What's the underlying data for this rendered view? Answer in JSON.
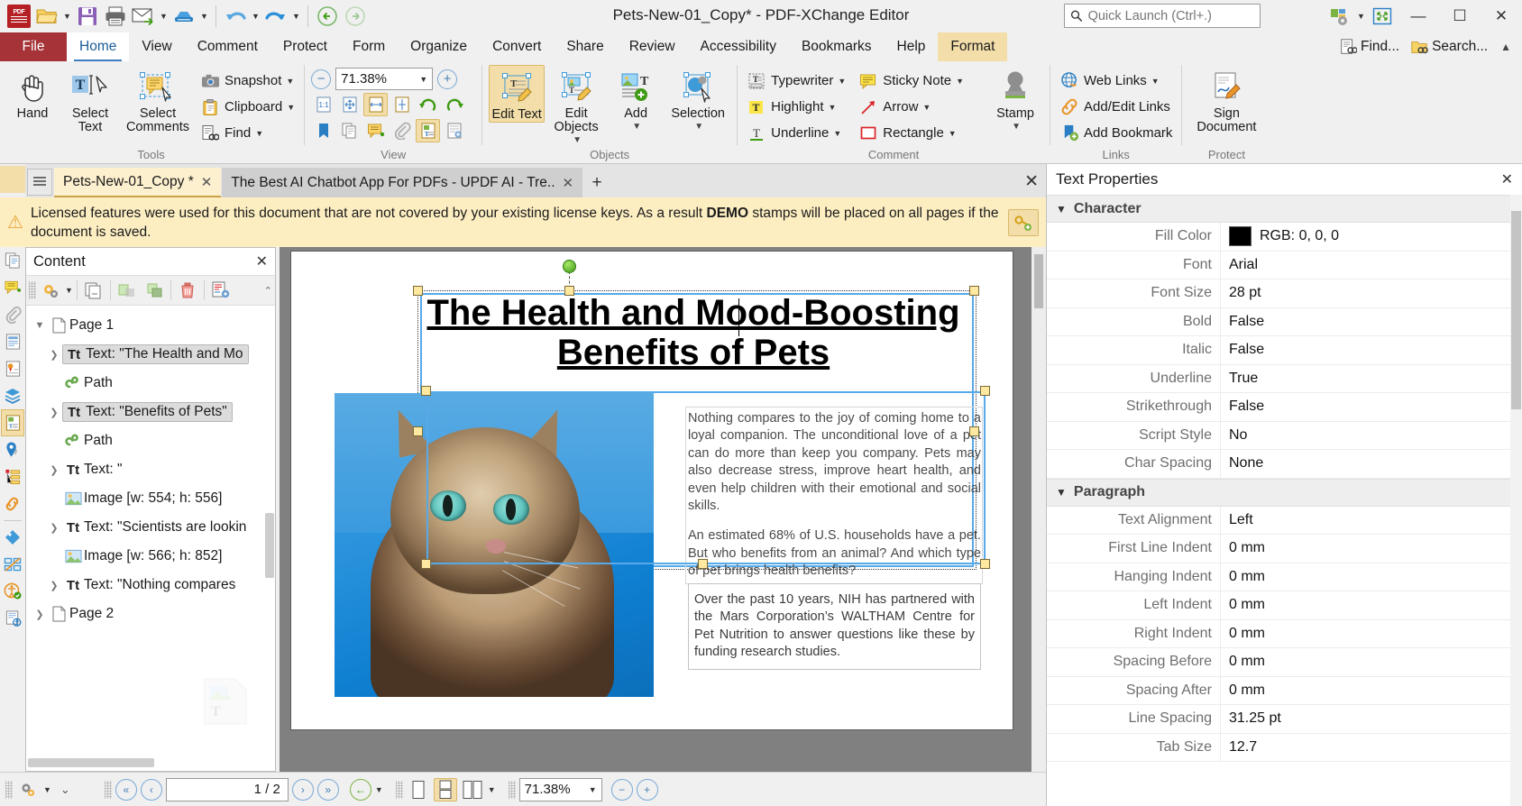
{
  "window": {
    "title": "Pets-New-01_Copy* - PDF-XChange Editor",
    "minimize_label": "—",
    "maximize_label": "☐",
    "close_label": "✕"
  },
  "quick_access": {
    "items": [
      {
        "name": "app-logo",
        "label": "PDF"
      },
      {
        "name": "open-file",
        "label": "Open"
      },
      {
        "name": "save-file",
        "label": "Save"
      },
      {
        "name": "print",
        "label": "Print"
      },
      {
        "name": "email",
        "label": "Email"
      },
      {
        "name": "scan",
        "label": "Scan"
      },
      {
        "name": "undo",
        "label": "Undo"
      },
      {
        "name": "redo",
        "label": "Redo"
      },
      {
        "name": "previous-view",
        "label": "Previous View"
      },
      {
        "name": "next-view",
        "label": "Next View"
      }
    ]
  },
  "quick_launch": {
    "placeholder": "Quick Launch (Ctrl+.)",
    "value": ""
  },
  "menu": {
    "file_label": "File",
    "tabs": [
      {
        "label": "Home",
        "state": "active"
      },
      {
        "label": "View",
        "state": "normal"
      },
      {
        "label": "Comment",
        "state": "normal"
      },
      {
        "label": "Protect",
        "state": "normal"
      },
      {
        "label": "Form",
        "state": "normal"
      },
      {
        "label": "Organize",
        "state": "normal"
      },
      {
        "label": "Convert",
        "state": "normal"
      },
      {
        "label": "Share",
        "state": "normal"
      },
      {
        "label": "Review",
        "state": "normal"
      },
      {
        "label": "Accessibility",
        "state": "normal"
      },
      {
        "label": "Bookmarks",
        "state": "normal"
      },
      {
        "label": "Help",
        "state": "normal"
      },
      {
        "label": "Format",
        "state": "contextual"
      }
    ],
    "right_items": [
      {
        "label": "Find...",
        "icon": "find-icon"
      },
      {
        "label": "Search...",
        "icon": "search-folder-icon"
      }
    ]
  },
  "ribbon": {
    "groups": [
      {
        "label": "Tools",
        "big_buttons": [
          {
            "label": "Hand",
            "icon": "hand-icon"
          },
          {
            "label": "Select Text",
            "icon": "select-text-icon"
          },
          {
            "label": "Select Comments",
            "icon": "select-comments-icon"
          }
        ],
        "list_items": [
          {
            "label": "Snapshot",
            "icon": "camera-icon",
            "has_caret": true
          },
          {
            "label": "Clipboard",
            "icon": "clipboard-icon",
            "has_caret": true
          },
          {
            "label": "Find",
            "icon": "find-binocular-icon",
            "has_caret": true
          }
        ]
      },
      {
        "label": "View",
        "zoom_value": "71.38%",
        "zoom_out_label": "−",
        "zoom_in_label": "+"
      },
      {
        "label": "Objects",
        "big_buttons": [
          {
            "label": "Edit Text",
            "icon": "edit-text-icon",
            "selected": true
          },
          {
            "label": "Edit Objects",
            "icon": "edit-objects-icon",
            "has_caret": true
          },
          {
            "label": "Add",
            "icon": "add-object-icon",
            "has_caret": true
          },
          {
            "label": "Selection",
            "icon": "selection-icon",
            "has_caret": true
          }
        ]
      },
      {
        "label": "Comment",
        "list_items": [
          {
            "label": "Typewriter",
            "icon": "typewriter-icon",
            "has_caret": true
          },
          {
            "label": "Highlight",
            "icon": "highlight-icon",
            "has_caret": true
          },
          {
            "label": "Underline",
            "icon": "underline-icon",
            "has_caret": true
          },
          {
            "label": "Sticky Note",
            "icon": "sticky-note-icon",
            "has_caret": true
          },
          {
            "label": "Arrow",
            "icon": "arrow-icon",
            "has_caret": true
          },
          {
            "label": "Rectangle",
            "icon": "rectangle-icon",
            "has_caret": true
          }
        ],
        "stamp": {
          "label": "Stamp",
          "icon": "stamp-icon"
        }
      },
      {
        "label": "Links",
        "list_items": [
          {
            "label": "Web Links",
            "icon": "globe-link-icon",
            "has_caret": true
          },
          {
            "label": "Add/Edit Links",
            "icon": "chain-link-icon"
          },
          {
            "label": "Add Bookmark",
            "icon": "add-bookmark-icon"
          }
        ]
      },
      {
        "label": "Protect",
        "big_buttons": [
          {
            "label": "Sign Document",
            "icon": "sign-document-icon"
          }
        ]
      }
    ]
  },
  "document_tabs": {
    "tabs": [
      {
        "label": "Pets-New-01_Copy *",
        "active": true,
        "close_label": "✕"
      },
      {
        "label": "The Best AI Chatbot App For PDFs - UPDF AI - Tre..",
        "active": false,
        "close_label": "✕"
      }
    ],
    "new_tab_label": "+",
    "close_all_label": "✕"
  },
  "banner": {
    "text_part1": "Licensed features were used for this document that are not covered by your existing license keys. As a result ",
    "text_bold": "DEMO",
    "text_part2": " stamps will be placed on all pages if the document is saved.",
    "action_icon": "add-license-key-icon"
  },
  "content_panel": {
    "title": "Content",
    "close_label": "✕",
    "toolbar": [
      {
        "name": "options-gear-icon",
        "has_caret": true
      },
      {
        "name": "duplicate-icon"
      },
      {
        "name": "move-up-icon"
      },
      {
        "name": "move-down-icon"
      },
      {
        "name": "delete-icon"
      },
      {
        "name": "properties-icon"
      }
    ],
    "tree": [
      {
        "level": 1,
        "label": "Page 1",
        "icon": "page-icon",
        "expander": "expanded",
        "selected": false
      },
      {
        "level": 2,
        "label": "Text: \"The Health and Mo",
        "icon": "text-icon",
        "expander": "collapsed",
        "selected": true
      },
      {
        "level": 2,
        "label": "Path",
        "icon": "path-icon",
        "expander": "none",
        "selected": false
      },
      {
        "level": 2,
        "label": "Text: \"Benefits of Pets\"",
        "icon": "text-icon",
        "expander": "collapsed",
        "selected": true
      },
      {
        "level": 2,
        "label": "Path",
        "icon": "path-icon",
        "expander": "none",
        "selected": false
      },
      {
        "level": 2,
        "label": "Text: \"",
        "icon": "text-icon",
        "expander": "collapsed",
        "selected": false
      },
      {
        "level": 2,
        "label": "Image [w: 554; h: 556]",
        "icon": "image-icon",
        "expander": "none",
        "selected": false
      },
      {
        "level": 2,
        "label": "Text: \"Scientists are lookin",
        "icon": "text-icon",
        "expander": "collapsed",
        "selected": false
      },
      {
        "level": 2,
        "label": "Image [w: 566; h: 852]",
        "icon": "image-icon",
        "expander": "none",
        "selected": false
      },
      {
        "level": 2,
        "label": "Text: \"Nothing compares",
        "icon": "text-icon",
        "expander": "collapsed",
        "selected": false
      },
      {
        "level": 1,
        "label": "Page 2",
        "icon": "page-icon",
        "expander": "collapsed",
        "selected": false
      }
    ]
  },
  "document": {
    "title_line1": "The Health and Mood-Boosting",
    "title_line2": "Benefits of Pets",
    "paragraph1": "Nothing compares to the joy of coming home to a loyal companion. The unconditional love of a pet can do more than keep you company. Pets may also decrease stress, improve heart health, and even help children with their emotional and social skills.",
    "paragraph2": "An estimated 68% of U.S. households have a pet. But who benefits from an animal? And which type of pet brings health benefits?",
    "paragraph3": "Over the past 10 years, NIH has partnered with the Mars Corporation’s WALTHAM Centre for Pet Nutrition to answer questions like these by funding research studies.",
    "image_alt": "cat-photograph"
  },
  "status_bar": {
    "page_indicator": "1 / 2",
    "zoom_value": "71.38%",
    "first_page_label": "«",
    "prev_page_label": "‹",
    "next_page_label": "›",
    "last_page_label": "»",
    "back_label": "←"
  },
  "properties_panel": {
    "title": "Text Properties",
    "close_label": "✕",
    "groups": [
      {
        "name": "Character",
        "expanded": true,
        "rows": [
          {
            "key": "Fill Color",
            "value": "RGB: 0, 0, 0",
            "swatch": "#000000"
          },
          {
            "key": "Font",
            "value": "Arial"
          },
          {
            "key": "Font Size",
            "value": "28 pt"
          },
          {
            "key": "Bold",
            "value": "False"
          },
          {
            "key": "Italic",
            "value": "False"
          },
          {
            "key": "Underline",
            "value": "True"
          },
          {
            "key": "Strikethrough",
            "value": "False"
          },
          {
            "key": "Script Style",
            "value": "No"
          },
          {
            "key": "Char Spacing",
            "value": "None"
          }
        ]
      },
      {
        "name": "Paragraph",
        "expanded": true,
        "rows": [
          {
            "key": "Text Alignment",
            "value": "Left"
          },
          {
            "key": "First Line Indent",
            "value": "0 mm"
          },
          {
            "key": "Hanging Indent",
            "value": "0 mm"
          },
          {
            "key": "Left Indent",
            "value": "0 mm"
          },
          {
            "key": "Right Indent",
            "value": "0 mm"
          },
          {
            "key": "Spacing Before",
            "value": "0 mm"
          },
          {
            "key": "Spacing After",
            "value": "0 mm"
          },
          {
            "key": "Line Spacing",
            "value": "31.25 pt"
          },
          {
            "key": "Tab Size",
            "value": "12.7"
          }
        ]
      }
    ]
  },
  "left_rail": {
    "icons": [
      {
        "name": "bookmarks-icon",
        "active": false
      },
      {
        "name": "pages-thumbnail-icon",
        "active": false
      },
      {
        "name": "comments-icon",
        "active": false
      },
      {
        "name": "attachments-icon",
        "active": false
      },
      {
        "name": "fields-icon",
        "active": false
      },
      {
        "name": "signatures-icon",
        "active": false
      },
      {
        "name": "layers-icon",
        "active": false
      },
      {
        "name": "content-icon",
        "active": true
      },
      {
        "name": "destinations-icon",
        "active": false
      },
      {
        "name": "structure-icon",
        "active": false
      },
      {
        "name": "links-icon",
        "active": false
      },
      {
        "name": "stamps-palette-icon",
        "active": false
      },
      {
        "name": "measurement-icon",
        "active": false
      },
      {
        "name": "accessibility-check-icon",
        "active": false
      },
      {
        "name": "tags-icon",
        "active": false
      }
    ]
  },
  "colors": {
    "accent": "#3f7fbf",
    "file_tab": "#a53337",
    "contextual_tab": "#f3deaa",
    "banner": "#fdeec2",
    "selection_blue": "#57a9e8",
    "handle_fill": "#ffe8a0"
  }
}
